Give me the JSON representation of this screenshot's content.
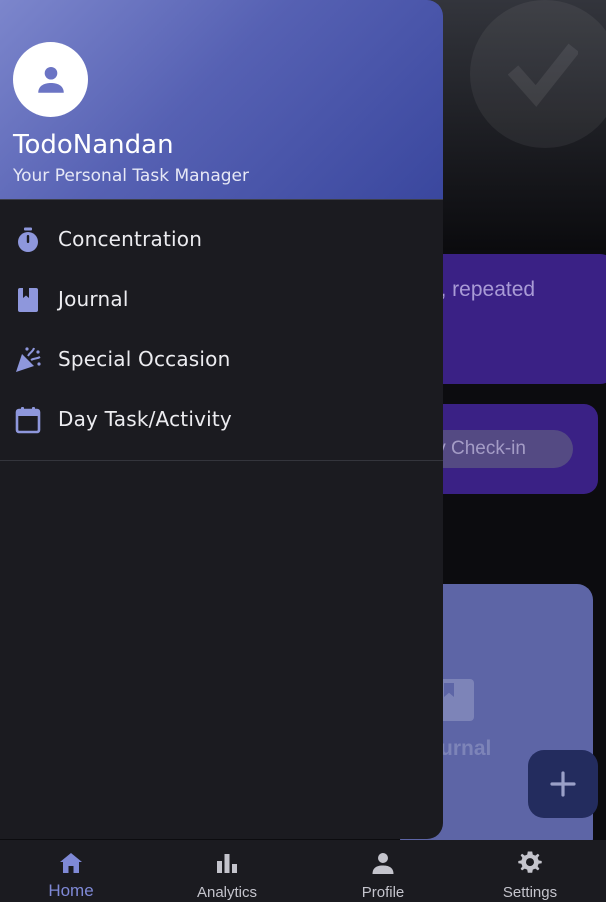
{
  "colors": {
    "accent": "#7f89d6",
    "drawer_bg": "#1b1b20",
    "header_gradient_start": "#7c86cc",
    "header_gradient_end": "#3a479e",
    "menu_icon": "#8e97dc"
  },
  "background": {
    "card_text": "s, repeated",
    "checkin_button": "ly Check-in",
    "journal_card_label": "urnal",
    "fab_icon": "plus-icon"
  },
  "drawer": {
    "avatar_icon": "person-icon",
    "app_name": "TodoNandan",
    "tagline": "Your Personal Task Manager",
    "items": [
      {
        "label": "Concentration",
        "icon": "timer-icon"
      },
      {
        "label": "Journal",
        "icon": "book-icon"
      },
      {
        "label": "Special Occasion",
        "icon": "celebration-icon"
      },
      {
        "label": "Day Task/Activity",
        "icon": "calendar-icon"
      }
    ]
  },
  "bottom_nav": {
    "active": "Home",
    "items": [
      {
        "label": "Home",
        "icon": "home-icon"
      },
      {
        "label": "Analytics",
        "icon": "bar-chart-icon"
      },
      {
        "label": "Profile",
        "icon": "person-icon"
      },
      {
        "label": "Settings",
        "icon": "gear-icon"
      }
    ]
  }
}
